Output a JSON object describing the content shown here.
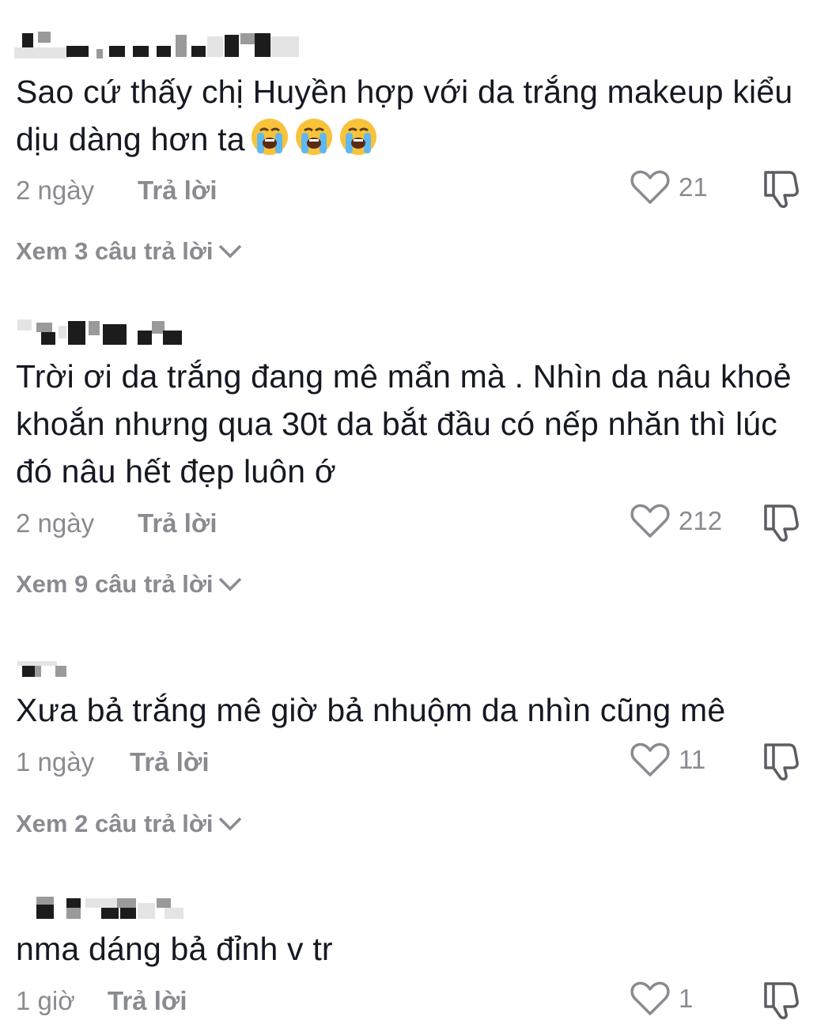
{
  "comments": [
    {
      "text": "Sao cứ thấy chị Huyền hợp với da trắng makeup kiểu dịu dàng hơn ta",
      "emojis": [
        "loudly-crying-face",
        "loudly-crying-face",
        "loudly-crying-face"
      ],
      "time": "2 ngày",
      "reply_label": "Trả lời",
      "likes": "21",
      "view_replies": "Xem 3 câu trả lời"
    },
    {
      "text": "Trời ơi da trắng đang mê mẩn mà . Nhìn da nâu khoẻ khoắn nhưng qua 30t da bắt đầu có nếp nhăn thì lúc đó nâu hết đẹp luôn ớ",
      "time": "2 ngày",
      "reply_label": "Trả lời",
      "likes": "212",
      "view_replies": "Xem 9 câu trả lời"
    },
    {
      "text": "Xưa bả trắng mê giờ bả nhuộm da nhìn cũng mê",
      "time": "1 ngày",
      "reply_label": "Trả lời",
      "likes": "11",
      "view_replies": "Xem 2 câu trả lời"
    },
    {
      "text": "nma dáng bả đỉnh v tr",
      "time": "1 giờ",
      "reply_label": "Trả lời",
      "likes": "1"
    }
  ],
  "icons": {
    "like": "heart-outline-icon",
    "dislike": "thumbs-down-icon",
    "expand": "chevron-down-icon"
  },
  "colors": {
    "text": "#161823",
    "muted": "#8a8b91",
    "background": "#ffffff"
  }
}
